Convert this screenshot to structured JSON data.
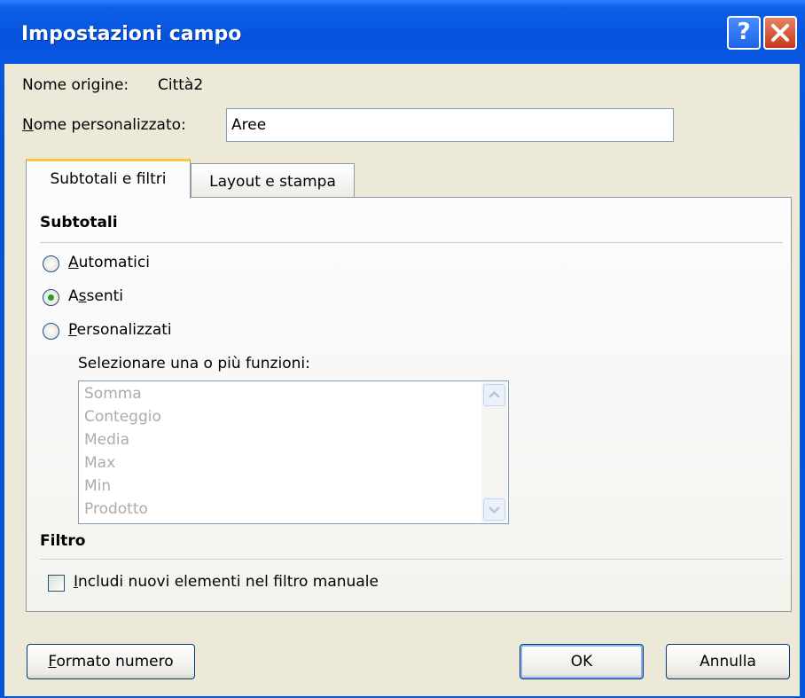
{
  "window": {
    "title": "Impostazioni campo",
    "help_label": "?",
    "close_label": "✕"
  },
  "source_name": {
    "label": "Nome origine:",
    "value": "Città2"
  },
  "custom_name": {
    "label_accel": "N",
    "label_rest": "ome personalizzato:",
    "value": "Aree"
  },
  "tabs": [
    {
      "label": "Subtotali e filtri",
      "active": true
    },
    {
      "label": "Layout e stampa",
      "active": false
    }
  ],
  "subtotals": {
    "heading": "Subtotali",
    "options": [
      {
        "pre": "",
        "accel": "A",
        "post": "utomatici",
        "selected": false
      },
      {
        "pre": "A",
        "accel": "s",
        "post": "senti",
        "selected": true
      },
      {
        "pre": "",
        "accel": "P",
        "post": "ersonalizzati",
        "selected": false
      }
    ],
    "functions_label": "Selezionare una o più funzioni:",
    "functions": [
      "Somma",
      "Conteggio",
      "Media",
      "Max",
      "Min",
      "Prodotto"
    ]
  },
  "filter": {
    "heading": "Filtro",
    "checkbox_accel": "I",
    "checkbox_rest": "ncludi nuovi elementi nel filtro manuale",
    "checked": false
  },
  "buttons": {
    "number_format_accel": "F",
    "number_format_rest": "ormato numero",
    "ok": "OK",
    "cancel": "Annulla"
  }
}
